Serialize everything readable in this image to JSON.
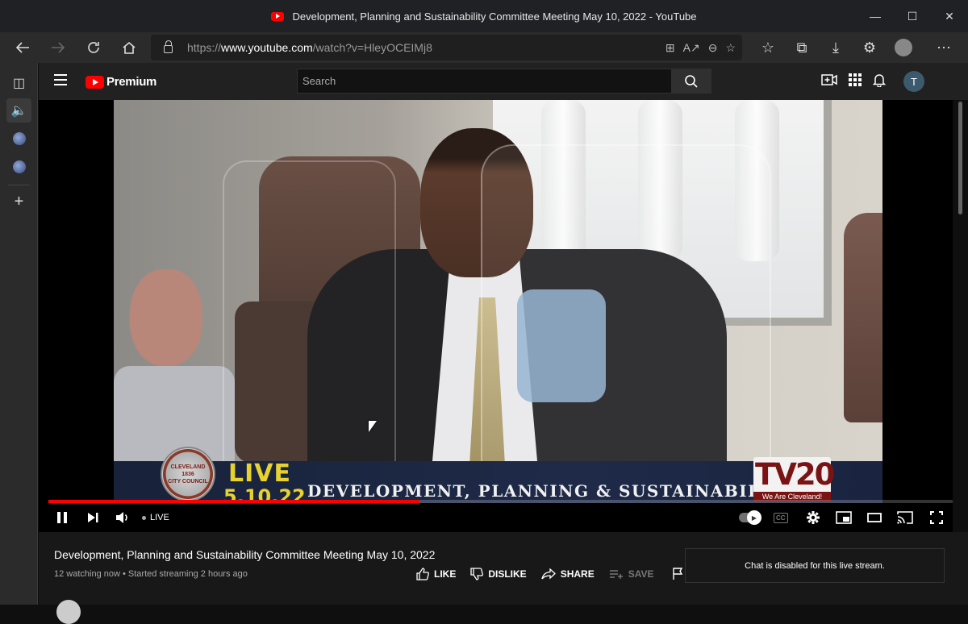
{
  "window": {
    "title": "Development, Planning and Sustainability Committee Meeting May 10, 2022 - YouTube"
  },
  "address_bar": {
    "url_proto": "https://",
    "url_host": "www.youtube.com",
    "url_path": "/watch?v=HleyOCEIMj8"
  },
  "youtube": {
    "brand": "Premium",
    "search_placeholder": "Search",
    "avatar_initial": "T"
  },
  "video": {
    "overlay": {
      "seal_text": "CLEVELAND\n1836\nCITY COUNCIL",
      "live": "LIVE",
      "date": "5.10.22",
      "committee": "DEVELOPMENT, PLANNING & SUSTAINABILITY",
      "tv_logo": "TV20",
      "tv_tagline": "We Are Cleveland!"
    },
    "progress_fraction": 0.41,
    "live_label": "LIVE"
  },
  "info": {
    "title": "Development, Planning and Sustainability Committee Meeting May 10, 2022",
    "meta": "12 watching now • Started streaming 2 hours ago",
    "like_label": "LIKE",
    "dislike_label": "DISLIKE",
    "share_label": "SHARE",
    "save_label": "SAVE"
  },
  "chat": {
    "message": "Chat is disabled for this live stream."
  },
  "colors": {
    "youtube_red": "#ff0000",
    "overlay_yellow": "#e8d22e",
    "tv20_red": "#7a1414"
  }
}
